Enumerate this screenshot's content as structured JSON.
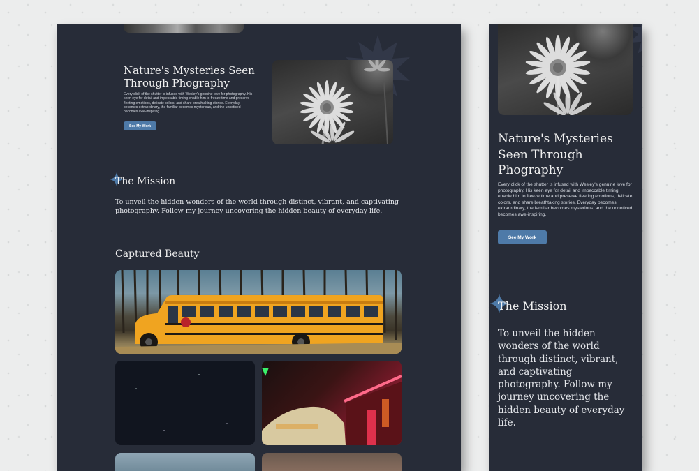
{
  "hero": {
    "title": "Nature's Mysteries Seen Through Phography",
    "body": "Every click of the shutter is infused with Wesley's genuine love for photography. His keen eye for detail and impeccable timing enable him to freeze time and preserve fleeting emotions, delicate colors, and share breathtaking stories. Everyday becomes extraordinary, the familiar becomes mysterious, and the unnoticed becomes awe-inspiring.",
    "button": "See My Work"
  },
  "mission": {
    "title": "The Mission",
    "text": "To unveil the hidden wonders of the world through distinct, vibrant, and captivating photography. Follow my journey uncovering the hidden beauty of everyday life."
  },
  "gallery": {
    "title": "Captured Beauty"
  },
  "colors": {
    "page_bg": "#eceded",
    "card_bg": "#272c38",
    "accent": "#4e7aa8",
    "text": "#f0f0f0"
  },
  "icons": [
    "sun-decoration-icon",
    "sparkle-icon"
  ]
}
